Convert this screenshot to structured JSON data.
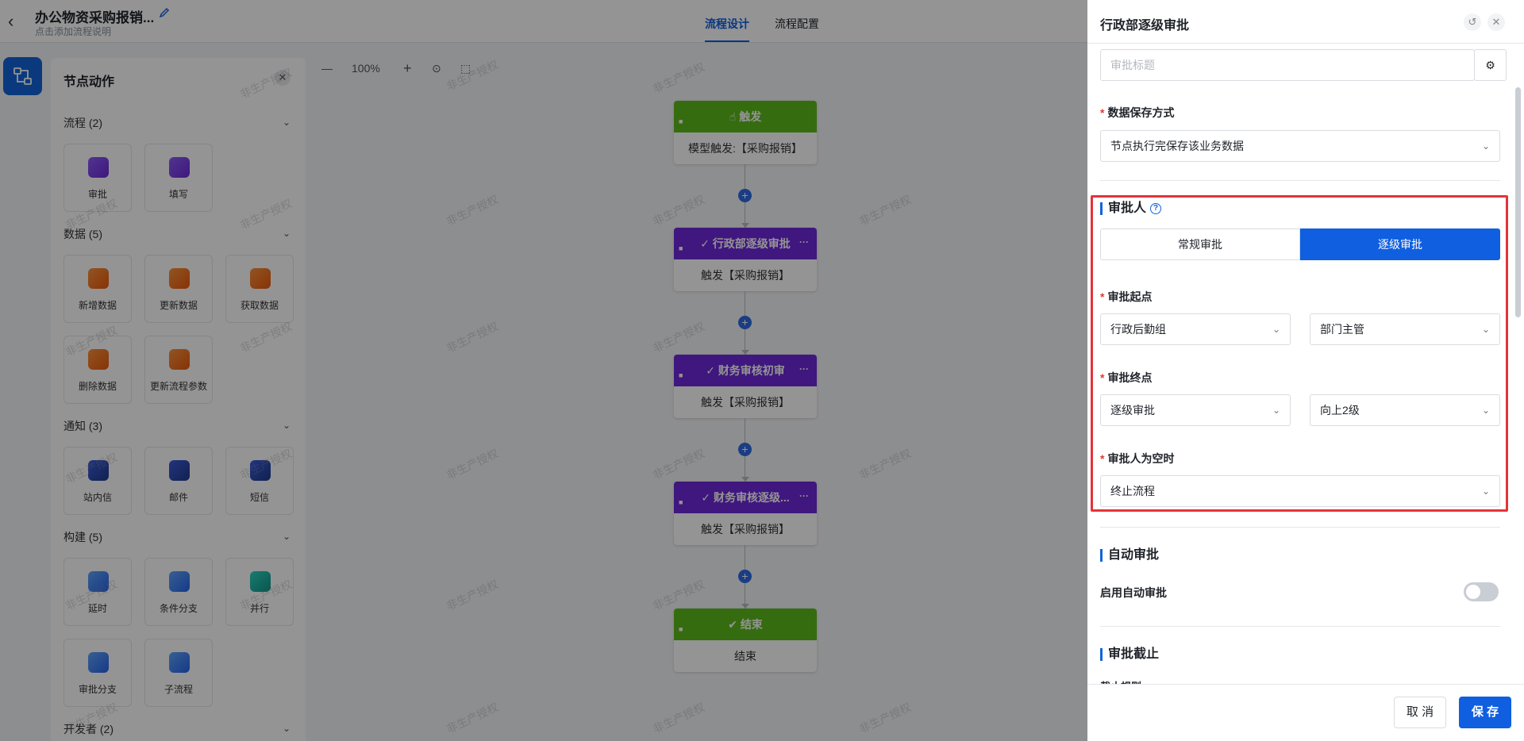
{
  "header": {
    "back_icon": "chevron-left-icon",
    "app_title": "办公物资采购报销...",
    "edit_icon": "pencil-icon",
    "app_desc": "点击添加流程说明",
    "tabs": [
      {
        "label": "流程设计",
        "active": true
      },
      {
        "label": "流程配置",
        "active": false
      }
    ]
  },
  "palette": {
    "title": "节点动作",
    "groups": [
      {
        "label": "流程 (2)",
        "items": [
          {
            "label": "审批",
            "icon": "approve-icon",
            "color": "purple"
          },
          {
            "label": "填写",
            "icon": "fill-form-icon",
            "color": "purple"
          }
        ]
      },
      {
        "label": "数据 (5)",
        "items": [
          {
            "label": "新增数据",
            "icon": "add-data-icon",
            "color": "orange"
          },
          {
            "label": "更新数据",
            "icon": "update-data-icon",
            "color": "orange"
          },
          {
            "label": "获取数据",
            "icon": "fetch-data-icon",
            "color": "orange"
          },
          {
            "label": "删除数据",
            "icon": "delete-data-icon",
            "color": "orange"
          },
          {
            "label": "更新流程参数",
            "icon": "update-param-icon",
            "color": "orange"
          }
        ]
      },
      {
        "label": "通知 (3)",
        "items": [
          {
            "label": "站内信",
            "icon": "bell-icon",
            "color": "navy"
          },
          {
            "label": "邮件",
            "icon": "mail-icon",
            "color": "navy"
          },
          {
            "label": "短信",
            "icon": "sms-icon",
            "color": "navy"
          }
        ]
      },
      {
        "label": "构建 (5)",
        "items": [
          {
            "label": "延时",
            "icon": "delay-icon",
            "color": "blue"
          },
          {
            "label": "条件分支",
            "icon": "condition-branch-icon",
            "color": "blue"
          },
          {
            "label": "并行",
            "icon": "parallel-icon",
            "color": "teal"
          },
          {
            "label": "审批分支",
            "icon": "approval-branch-icon",
            "color": "blue"
          },
          {
            "label": "子流程",
            "icon": "subflow-icon",
            "color": "blue"
          }
        ]
      },
      {
        "label": "开发者 (2)",
        "items": []
      }
    ]
  },
  "canvas": {
    "zoom": "100%",
    "zoom_out_icon": "minus-icon",
    "zoom_in_icon": "plus-icon",
    "locate_icon": "target-icon",
    "select_icon": "select-icon",
    "nodes": [
      {
        "title": "触发",
        "body": "模型触发:【采购报销】",
        "color": "green",
        "icon": "hand-icon"
      },
      {
        "title": "行政部逐级审批",
        "body": "触发【采购报销】",
        "color": "purple",
        "icon": "clipboard-check-icon"
      },
      {
        "title": "财务审核初审",
        "body": "触发【采购报销】",
        "color": "purple",
        "icon": "clipboard-check-icon"
      },
      {
        "title": "财务审核逐级...",
        "body": "触发【采购报销】",
        "color": "purple",
        "icon": "clipboard-check-icon"
      },
      {
        "title": "结束",
        "body": "结束",
        "color": "green",
        "icon": "check-circle-icon"
      }
    ],
    "watermark": "非生产授权"
  },
  "drawer": {
    "title": "行政部逐级审批",
    "reset_icon": "reset-icon",
    "close_icon": "close-icon",
    "approval_title_placeholder": "审批标题",
    "settings_icon": "gear-icon",
    "save_mode_label": "数据保存方式",
    "save_mode_value": "节点执行完保存该业务数据",
    "approver_section": "审批人",
    "help_icon": "question-icon",
    "mode_tabs": [
      {
        "label": "常规审批",
        "active": false
      },
      {
        "label": "逐级审批",
        "active": true
      }
    ],
    "start_label": "审批起点",
    "start_value_1": "行政后勤组",
    "start_value_2": "部门主管",
    "end_label": "审批终点",
    "end_value_1": "逐级审批",
    "end_value_2": "向上2级",
    "empty_label": "审批人为空时",
    "empty_value": "终止流程",
    "auto_section": "自动审批",
    "auto_enable_label": "启用自动审批",
    "auto_enable": false,
    "deadline_section": "审批截止",
    "deadline_rule_label": "截止规则",
    "cancel_label": "取 消",
    "save_label": "保 存"
  },
  "colors": {
    "primary": "#0f5fe0",
    "highlight": "#e5333a",
    "node_green": "#5dbb1c",
    "node_purple": "#6d28d9"
  }
}
